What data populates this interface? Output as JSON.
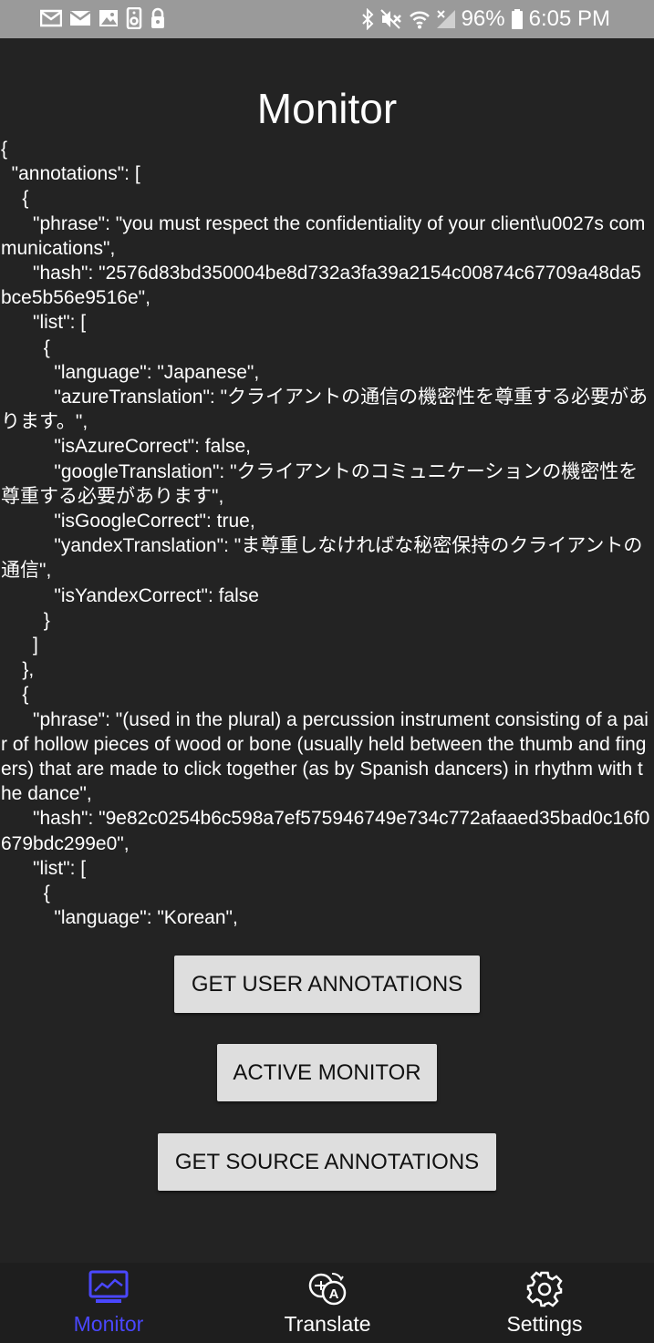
{
  "status_bar": {
    "battery": "96%",
    "time": "6:05 PM",
    "left_icons": [
      "email-icon",
      "email-icon",
      "image-icon",
      "media-icon",
      "lock-icon"
    ],
    "right_icons": [
      "bluetooth-icon",
      "mute-icon",
      "wifi-icon",
      "signal-icon",
      "battery-icon"
    ]
  },
  "title": "Monitor",
  "json_text": "{\n  \"annotations\": [\n    {\n      \"phrase\": \"you must respect the confidentiality of your client\\u0027s communications\",\n      \"hash\": \"2576d83bd350004be8d732a3fa39a2154c00874c67709a48da5bce5b56e9516e\",\n      \"list\": [\n        {\n          \"language\": \"Japanese\",\n          \"azureTranslation\": \"クライアントの通信の機密性を尊重する必要があります。\",\n          \"isAzureCorrect\": false,\n          \"googleTranslation\": \"クライアントのコミュニケーションの機密性を尊重する必要があります\",\n          \"isGoogleCorrect\": true,\n          \"yandexTranslation\": \"ま尊重しなければな秘密保持のクライアントの通信\",\n          \"isYandexCorrect\": false\n        }\n      ]\n    },\n    {\n      \"phrase\": \"(used in the plural) a percussion instrument consisting of a pair of hollow pieces of wood or bone (usually held between the thumb and fingers) that are made to click together (as by Spanish dancers) in rhythm with the dance\",\n      \"hash\": \"9e82c0254b6c598a7ef575946749e734c772afaaed35bad0c16f0679bdc299e0\",\n      \"list\": [\n        {\n          \"language\": \"Korean\",",
  "buttons": {
    "get_user_annotations": "GET USER ANNOTATIONS",
    "active_monitor": "ACTIVE MONITOR",
    "get_source_annotations": "GET SOURCE ANNOTATIONS"
  },
  "nav": {
    "items": [
      {
        "label": "Monitor",
        "icon": "monitor-icon",
        "active": true
      },
      {
        "label": "Translate",
        "icon": "translate-icon",
        "active": false
      },
      {
        "label": "Settings",
        "icon": "gear-icon",
        "active": false
      }
    ],
    "active_color": "#4a47ff"
  },
  "colors": {
    "background": "#232323",
    "status_bar": "#9a9a9a",
    "button": "#dedede"
  }
}
